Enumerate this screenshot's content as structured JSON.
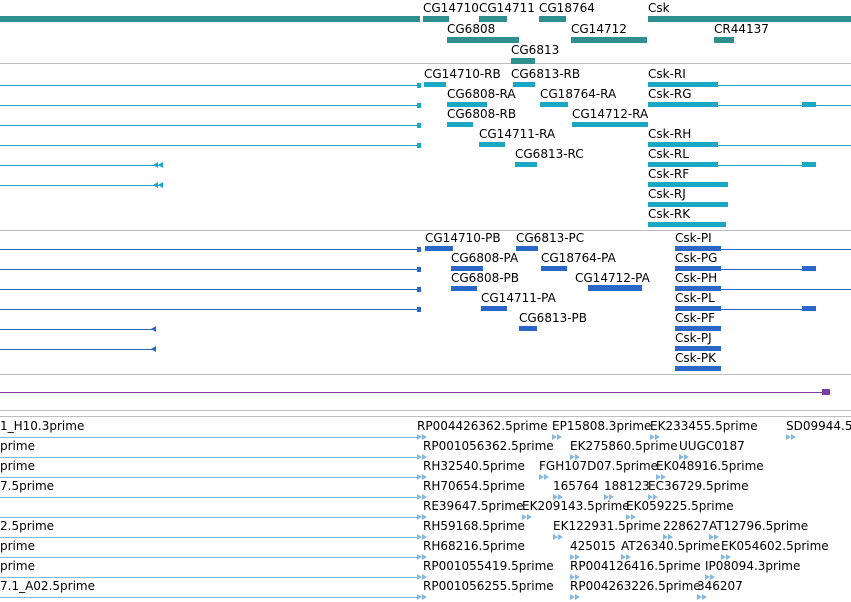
{
  "colors": {
    "gene": "#2f8f8f",
    "transcript_cg": "#1aa7c4",
    "transcript_pf": "#2b67c9",
    "misc": "#7a3fa0",
    "est": "#86b9dd",
    "separator": "#bfbfbf"
  },
  "genes": {
    "labels": [
      "CG14710",
      "CG14711",
      "CG18764",
      "Csk",
      "CG6808",
      "CG14712",
      "CR44137",
      "CG6813"
    ]
  },
  "transcripts_cg": {
    "labels": [
      "CG14710-RB",
      "CG6813-RB",
      "Csk-RI",
      "CG6808-RA",
      "CG18764-RA",
      "Csk-RG",
      "CG6808-RB",
      "CG14712-RA",
      "CG14711-RA",
      "Csk-RH",
      "CG6813-RC",
      "Csk-RL",
      "Csk-RF",
      "Csk-RJ",
      "Csk-RK"
    ]
  },
  "transcripts_pf": {
    "labels": [
      "CG14710-PB",
      "CG6813-PC",
      "Csk-PI",
      "CG6808-PA",
      "CG18764-PA",
      "Csk-PG",
      "CG6808-PB",
      "CG14712-PA",
      "Csk-PH",
      "CG14711-PA",
      "Csk-PL",
      "CG6813-PB",
      "Csk-PF",
      "Csk-PJ",
      "Csk-PK"
    ]
  },
  "ests": {
    "labels": [
      "1_H10.3prime",
      "RP004426362.5prime",
      "EP15808.3prime",
      "EK233455.5prime",
      "SD09944.5",
      "prime",
      "RP001056362.5prime",
      "EK275860.5prime",
      "UUGC0187",
      "prime",
      "RH32540.5prime",
      "FGH107D07.5prime",
      "EK048916.5prime",
      "7.5prime",
      "RH70654.5prime",
      "165764",
      "188123",
      "EC36729.5prime",
      "RE39647.5prime",
      "EK209143.5prime",
      "EK059225.5prime",
      "2.5prime",
      "RH59168.5prime",
      "EK122931.5prime",
      "228627",
      "AT12796.5prime",
      "prime",
      "RH68216.5prime",
      "425015",
      "AT26340.5prime",
      "EK054602.5prime",
      "prime",
      "RP001055419.5prime",
      "RP004126416.5prime",
      "IP08094.3prime",
      "7.1_A02.5prime",
      "RP001056255.5prime",
      "RP004263226.5prime",
      "346207"
    ]
  }
}
